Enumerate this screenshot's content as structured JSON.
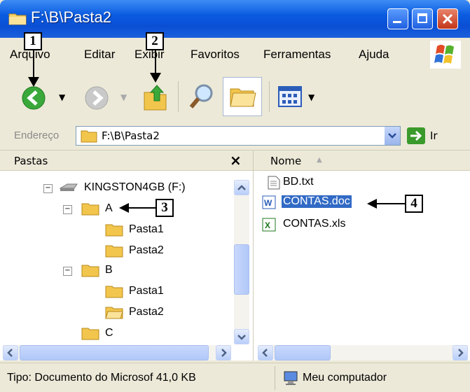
{
  "window": {
    "title": "F:\\B\\Pasta2"
  },
  "menubar": {
    "items": [
      "Arquivo",
      "Editar",
      "Exibir",
      "Favoritos",
      "Ferramentas",
      "Ajuda"
    ]
  },
  "toolbar": {
    "buttons": [
      "back-icon",
      "forward-icon",
      "up-folder-icon",
      "search-icon",
      "folders-icon",
      "views-icon"
    ]
  },
  "address": {
    "label": "Endereço",
    "value": "F:\\B\\Pasta2",
    "go_label": "Ir"
  },
  "folders_pane": {
    "title": "Pastas",
    "close_label": "×",
    "tree": [
      {
        "label": "KINGSTON4GB (F:)"
      },
      {
        "label": "A"
      },
      {
        "label": "Pasta1"
      },
      {
        "label": "Pasta2"
      },
      {
        "label": "B"
      },
      {
        "label": "Pasta1"
      },
      {
        "label": "Pasta2"
      },
      {
        "label": "C"
      }
    ]
  },
  "files_pane": {
    "column_name": "Nome",
    "files": [
      {
        "name": "BD.txt"
      },
      {
        "name": "CONTAS.doc",
        "selected": true
      },
      {
        "name": "CONTAS.xls"
      }
    ]
  },
  "statusbar": {
    "type_text": "Tipo: Documento do Microsof 41,0 KB",
    "location": "Meu computador"
  },
  "callouts": [
    "1",
    "2",
    "3",
    "4"
  ],
  "colors": {
    "titlebar": "#0a4fd4",
    "selection": "#316ac5",
    "chrome": "#ece9d8"
  }
}
